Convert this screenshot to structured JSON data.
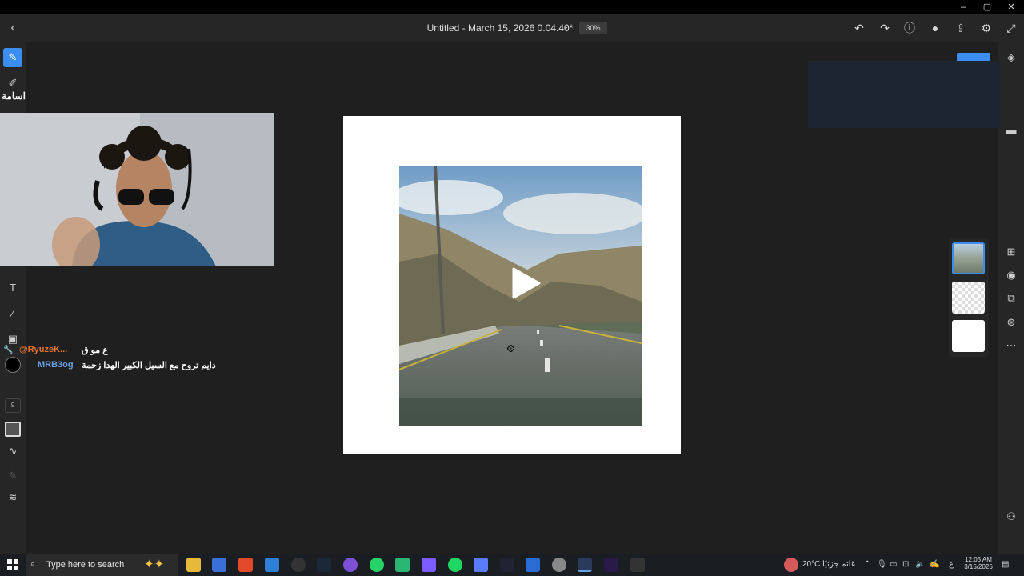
{
  "window": {
    "minimize": "–",
    "maximize": "▢",
    "close": "✕"
  },
  "header": {
    "title": "Untitled - March 15, 2026 0.04.40*",
    "zoom": "30%"
  },
  "left_toolbar": {
    "brush_size": "9"
  },
  "stream_overlay": {
    "username": "اسامة",
    "chat": [
      {
        "user": "@RyuzeK...",
        "message": "ع مو ق",
        "user_color": "#e0742c"
      },
      {
        "user": "MRB3og",
        "message": "دايم تروح مع السيل الكبير الهدا زحمة",
        "user_color": "#6aa2e8"
      }
    ]
  },
  "taskbar": {
    "search_placeholder": "Type here to search",
    "weather": "20°C",
    "weather_desc": "غائم جزئيًا",
    "time": "12:05 AM",
    "date": "3/15/2026",
    "lang": "ع"
  },
  "colors": {
    "accent": "#3b8ef0",
    "toolbar_bg": "#262626",
    "workspace_bg": "#1f1f1f"
  }
}
